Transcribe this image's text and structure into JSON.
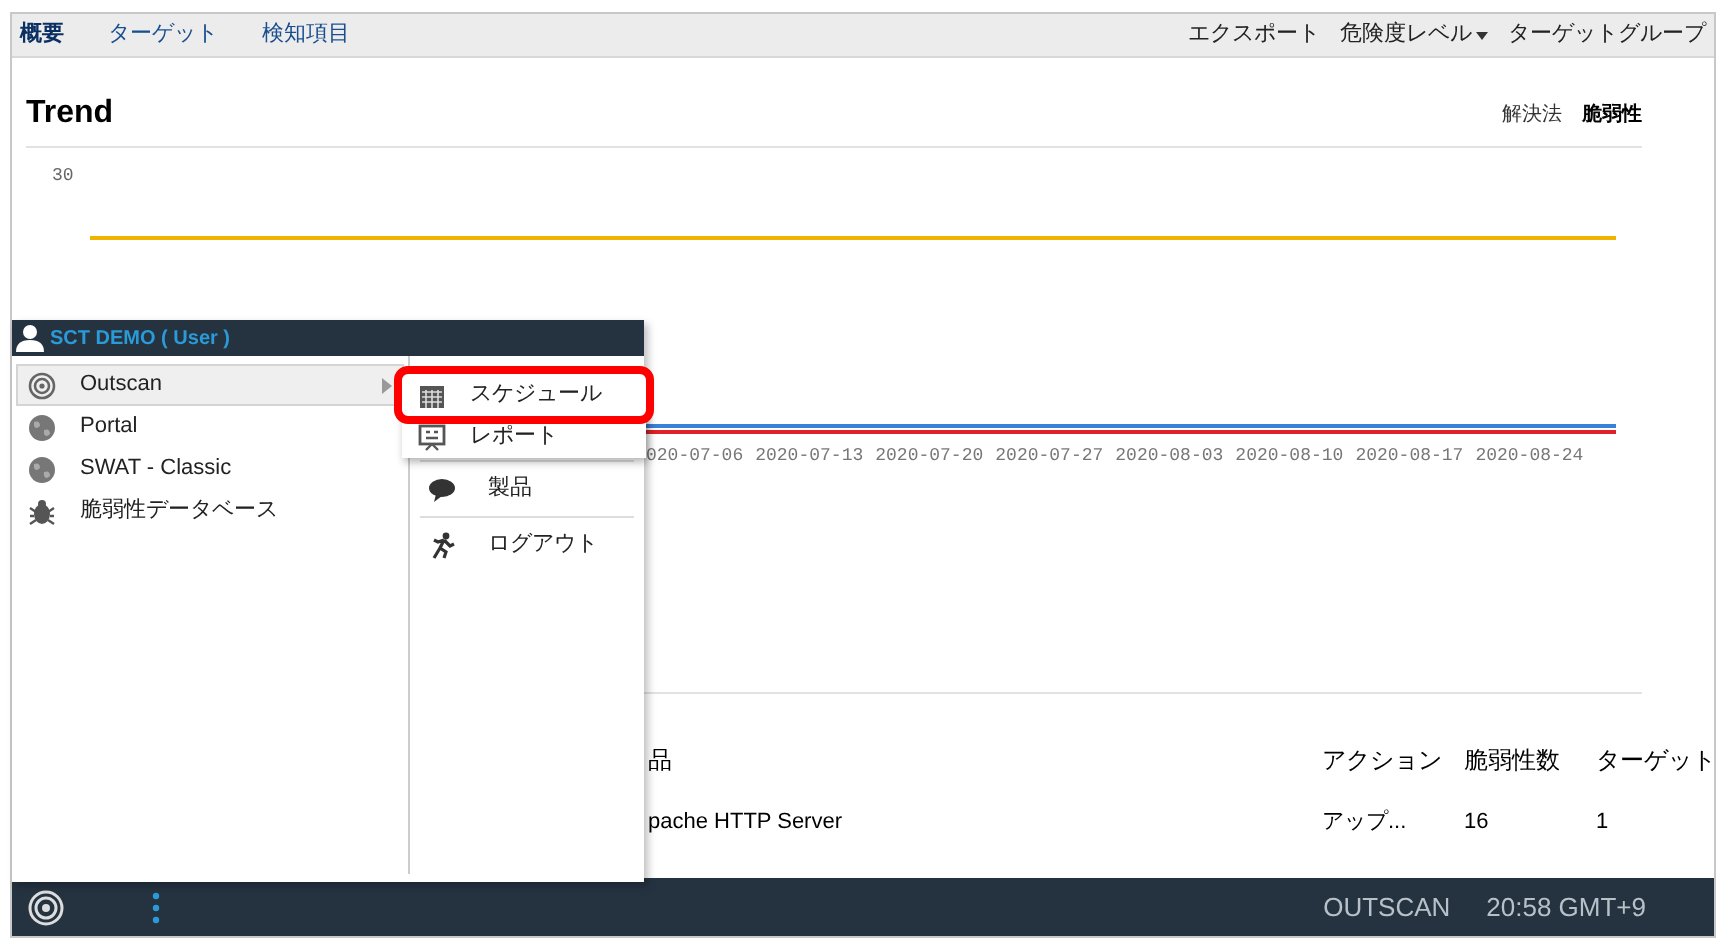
{
  "nav": {
    "left": [
      {
        "label": "概要",
        "selected": true
      },
      {
        "label": "ターゲット",
        "selected": false
      },
      {
        "label": "検知項目",
        "selected": false
      }
    ],
    "right": [
      {
        "label": "エクスポート",
        "kind": "link"
      },
      {
        "label": "危険度レベル",
        "kind": "dropdown"
      },
      {
        "label": "ターゲットグループ",
        "kind": "link"
      }
    ]
  },
  "trend": {
    "title": "Trend",
    "tabs": [
      {
        "label": "解決法",
        "selected": false
      },
      {
        "label": "脆弱性",
        "selected": true
      }
    ],
    "chart": {
      "y_tick": "30",
      "x_labels": [
        "020-07-06",
        "2020-07-13",
        "2020-07-20",
        "2020-07-27",
        "2020-08-03",
        "2020-08-10",
        "2020-08-17",
        "2020-08-24"
      ]
    }
  },
  "table": {
    "columns": [
      "品",
      "アクション",
      "脆弱性数",
      "ターゲット"
    ],
    "rows": [
      [
        "pache HTTP Server",
        "アップ...",
        "16",
        "1"
      ]
    ]
  },
  "menu": {
    "user": "SCT DEMO ( User )",
    "apps": [
      {
        "label": "Outscan",
        "kind": "radar",
        "selected": true,
        "has_submenu": true
      },
      {
        "label": "Portal",
        "kind": "globe",
        "selected": false,
        "has_submenu": false
      },
      {
        "label": "SWAT - Classic",
        "kind": "globe",
        "selected": false,
        "has_submenu": false
      },
      {
        "label": "脆弱性データベース",
        "kind": "bug",
        "selected": false,
        "has_submenu": false
      }
    ],
    "submenu": [
      {
        "label": "スケジュール",
        "kind": "calendar",
        "highlighted": true
      },
      {
        "label": "レポート",
        "kind": "presentation",
        "highlighted": false
      }
    ],
    "actions": [
      {
        "label": "製品",
        "kind": "speech"
      },
      {
        "label": "ログアウト",
        "kind": "runner"
      }
    ]
  },
  "taskbar": {
    "product": "OUTSCAN",
    "clock": "20:58 GMT+9"
  }
}
